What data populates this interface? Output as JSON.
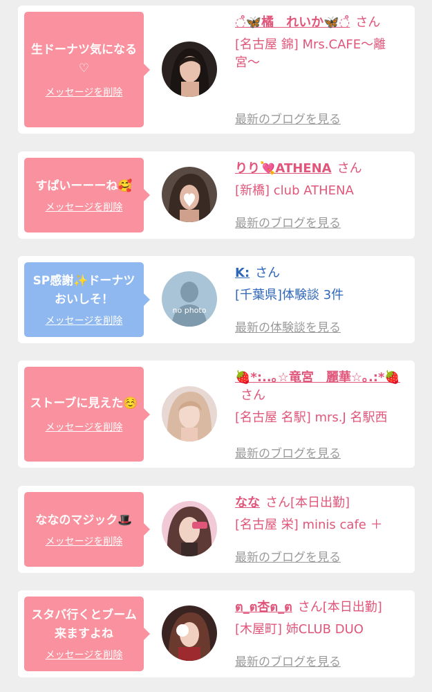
{
  "delete_label": "メッセージを削除",
  "items": [
    {
      "message": "生ドーナツ気になる♡",
      "name": "◌̊🦋橘　れいか🦋◌̊",
      "suffix": "さん",
      "shop": "[名古屋 錦] Mrs.CAFE〜離宮〜",
      "link": "最新のブログを見る"
    },
    {
      "message": "すぱいーーーね🥰",
      "name": "りり💘ATHENA",
      "suffix": "さん",
      "shop": "[新橋] club ATHENA",
      "link": "最新のブログを見る"
    },
    {
      "message": "SP感謝✨ドーナツおいしそ！",
      "name": "K:",
      "suffix": "さん",
      "shop": "[千葉県]体験談 3件",
      "link": "最新の体験談を見る",
      "avatar_text": "no photo"
    },
    {
      "message": "ストーブに見えた☺️",
      "name": "🍓*:..｡☆竜宮　麗華☆｡.:*🍓",
      "suffix": "さん",
      "shop": "[名古屋 名駅] mrs.J 名駅西",
      "link": "最新のブログを見る"
    },
    {
      "message": "ななのマジック🎩",
      "name": "なな",
      "suffix": "さん[本日出勤]",
      "shop": "[名古屋 栄] minis cafe ＋",
      "link": "最新のブログを見る"
    },
    {
      "message": "スタバ行くとブーム来ますよね",
      "name": "ต_ต杏ต_ต",
      "suffix": "さん[本日出勤]",
      "shop": "[木屋町] 姉CLUB DUO",
      "link": "最新のブログを見る"
    }
  ],
  "colors": {
    "pink_bubble": "#f9919e",
    "blue_bubble": "#8eb8ef",
    "pink_text": "#e0567a",
    "blue_text": "#2f67b8",
    "link_gray": "#9a9a9a"
  }
}
